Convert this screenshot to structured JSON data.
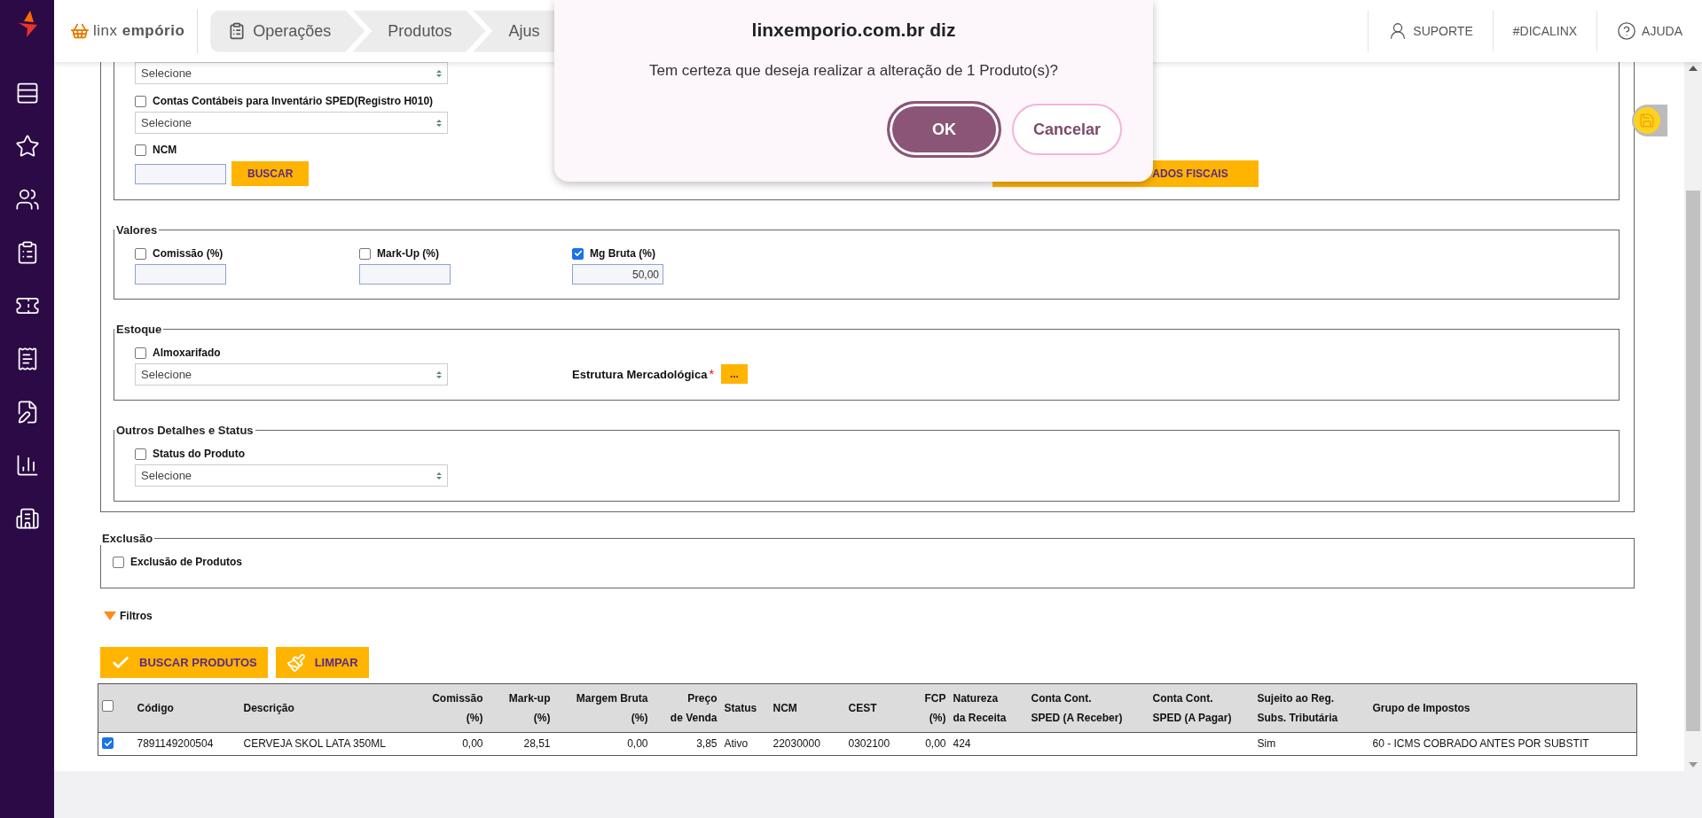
{
  "header": {
    "brand": "linx **empório**",
    "breadcrumbs": [
      {
        "label": "Operações"
      },
      {
        "label": "Produtos"
      },
      {
        "label": "Ajus"
      }
    ],
    "links": [
      {
        "label": "SUPORTE",
        "kind": "user"
      },
      {
        "label": "#DICALINX",
        "kind": "plain"
      },
      {
        "label": "AJUDA",
        "kind": "help"
      }
    ]
  },
  "dialog": {
    "title": "linxemporio.com.br diz",
    "message": "Tem certeza que deseja realizar a alteração de 1 Produto(s)?",
    "buttons": [
      {
        "label": "OK",
        "kind": "primary"
      },
      {
        "label": "Cancelar",
        "kind": "secondary"
      }
    ]
  },
  "fiscal": {
    "top_select": "Selecione",
    "accounts": {
      "label": "Contas Contábeis para Inventário SPED(Registro H010)",
      "checked": false,
      "value": "Selecione"
    },
    "ncm": {
      "label": "NCM",
      "checked": false,
      "button": "BUSCAR"
    },
    "side_button": "ADOS FISCAIS"
  },
  "valores": {
    "legend": "Valores",
    "fields": [
      {
        "label": "Comissão (%)",
        "checked": false
      },
      {
        "label": "Mark-Up (%)",
        "checked": false
      },
      {
        "label": "Mg Bruta (%)",
        "checked": true,
        "value": "50,00"
      }
    ]
  },
  "estoque": {
    "legend": "Estoque",
    "field": {
      "label": "Almoxarifado",
      "checked": false,
      "value": "Selecione"
    },
    "structure": {
      "label": "Estrutura Mercadológica",
      "required_mark": "*",
      "button": "..."
    }
  },
  "outros": {
    "legend": "Outros Detalhes e Status",
    "field": {
      "label": "Status do Produto",
      "checked": false,
      "value": "Selecione"
    }
  },
  "exclusao": {
    "legend": "Exclusão",
    "field": {
      "label": "Exclusão de Produtos",
      "checked": false
    }
  },
  "filters": {
    "label": "Filtros",
    "expanded": true
  },
  "actions": [
    {
      "label": "BUSCAR PRODUTOS",
      "kind": "check"
    },
    {
      "label": "LIMPAR",
      "kind": "broom"
    }
  ],
  "table": {
    "select_all": false,
    "columns": [
      "Código",
      "Descrição",
      "Comissão\n(%)",
      "Mark-up\n(%)",
      "Margem Bruta\n(%)",
      "Preço\nde Venda",
      "Status",
      "NCM",
      "CEST",
      "FCP\n(%)",
      "Natureza\nda Receita",
      "Conta Cont.\nSPED (A Receber)",
      "Conta Cont.\nSPED (A Pagar)",
      "Sujeito ao Reg.\nSubs. Tributária",
      "Grupo de Impostos"
    ],
    "rows": [
      {
        "selected": true,
        "cells": [
          "7891149200504",
          "CERVEJA SKOL LATA 350ML",
          "0,00",
          "28,51",
          "0,00",
          "3,85",
          "Ativo",
          "22030000",
          "0302100",
          "0,00",
          "424",
          null,
          null,
          "Sim",
          "60 - ICMS COBRADO ANTES POR SUBSTIT"
        ]
      }
    ]
  }
}
